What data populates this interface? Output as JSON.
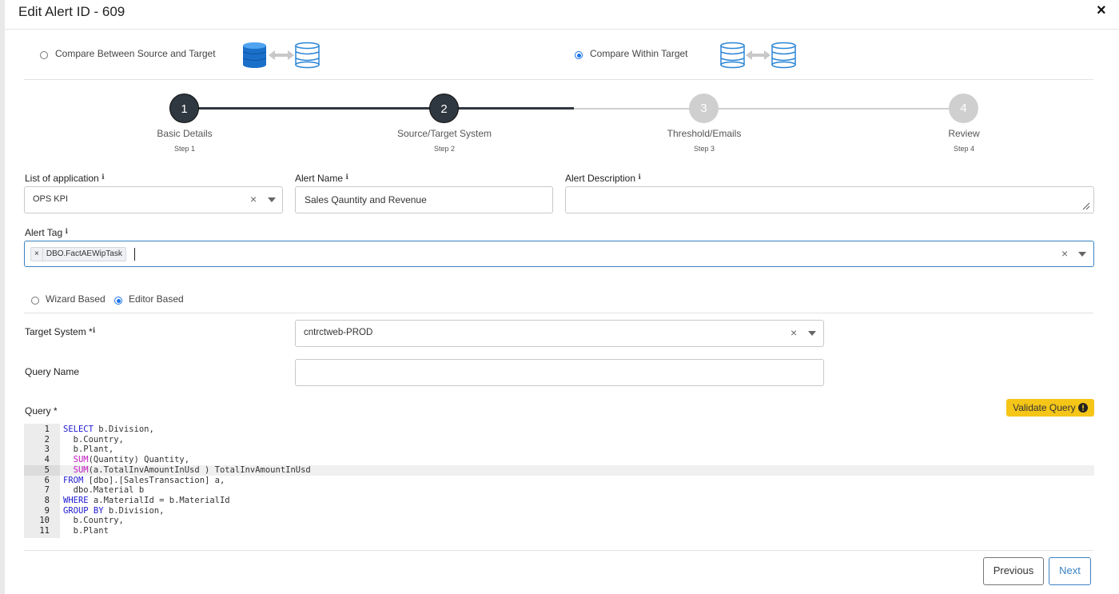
{
  "dialog": {
    "title": "Edit Alert ID - 609",
    "close_icon": "×"
  },
  "compare_mode": {
    "options": [
      {
        "label": "Compare Between Source and Target",
        "selected": false
      },
      {
        "label": "Compare Within Target",
        "selected": true
      }
    ]
  },
  "stepper": {
    "steps": [
      {
        "number": "1",
        "name": "Basic Details",
        "sub": "Step 1",
        "state": "done"
      },
      {
        "number": "2",
        "name": "Source/Target System",
        "sub": "Step 2",
        "state": "active"
      },
      {
        "number": "3",
        "name": "Threshold/Emails",
        "sub": "Step 3",
        "state": "pending"
      },
      {
        "number": "4",
        "name": "Review",
        "sub": "Step 4",
        "state": "pending"
      }
    ]
  },
  "form": {
    "application": {
      "label": "List of application",
      "value": "OPS KPI"
    },
    "alert_name": {
      "label": "Alert Name",
      "value": "Sales Qauntity and Revenue"
    },
    "alert_description": {
      "label": "Alert Description",
      "value": ""
    },
    "alert_tag": {
      "label": "Alert Tag",
      "tags": [
        "DBO.FactAEWipTask"
      ]
    },
    "mode": {
      "options": [
        {
          "label": "Wizard Based",
          "selected": false
        },
        {
          "label": "Editor Based",
          "selected": true
        }
      ]
    },
    "target_system": {
      "label": "Target System *",
      "value": "cntrctweb-PROD"
    },
    "query_name": {
      "label": "Query Name",
      "value": ""
    },
    "query": {
      "label": "Query *"
    }
  },
  "validate_button": {
    "label": "Validate Query",
    "icon": "info-icon"
  },
  "query_lines": [
    {
      "n": "1",
      "parts": [
        [
          "kw",
          "SELECT"
        ],
        [
          "t",
          " b.Division,"
        ]
      ]
    },
    {
      "n": "2",
      "parts": [
        [
          "t",
          "  b.Country,"
        ]
      ]
    },
    {
      "n": "3",
      "parts": [
        [
          "t",
          "  b.Plant,"
        ]
      ]
    },
    {
      "n": "4",
      "parts": [
        [
          "fn",
          "  SUM"
        ],
        [
          "t",
          "(Quantity) Quantity,"
        ]
      ]
    },
    {
      "n": "5",
      "parts": [
        [
          "fn",
          "  SUM"
        ],
        [
          "t",
          "(a.TotalInvAmountInUsd ) TotalInvAmountInUsd"
        ]
      ],
      "highlight": true
    },
    {
      "n": "6",
      "parts": [
        [
          "kw",
          "FROM"
        ],
        [
          "t",
          " [dbo].[SalesTransaction] a,"
        ]
      ]
    },
    {
      "n": "7",
      "parts": [
        [
          "t",
          "  dbo.Material b"
        ]
      ]
    },
    {
      "n": "8",
      "parts": [
        [
          "kw",
          "WHERE"
        ],
        [
          "t",
          " a.MaterialId = b.MaterialId"
        ]
      ]
    },
    {
      "n": "9",
      "parts": [
        [
          "kw",
          "GROUP BY"
        ],
        [
          "t",
          " b.Division,"
        ]
      ]
    },
    {
      "n": "10",
      "parts": [
        [
          "t",
          "  b.Country,"
        ]
      ]
    },
    {
      "n": "11",
      "parts": [
        [
          "t",
          "  b.Plant"
        ]
      ]
    }
  ],
  "footer": {
    "previous_label": "Previous",
    "next_label": "Next"
  },
  "colors": {
    "accent": "#1a73e8",
    "validate": "#f5c518",
    "step_done": "#2f3740",
    "step_pending": "#cfcfcf"
  }
}
